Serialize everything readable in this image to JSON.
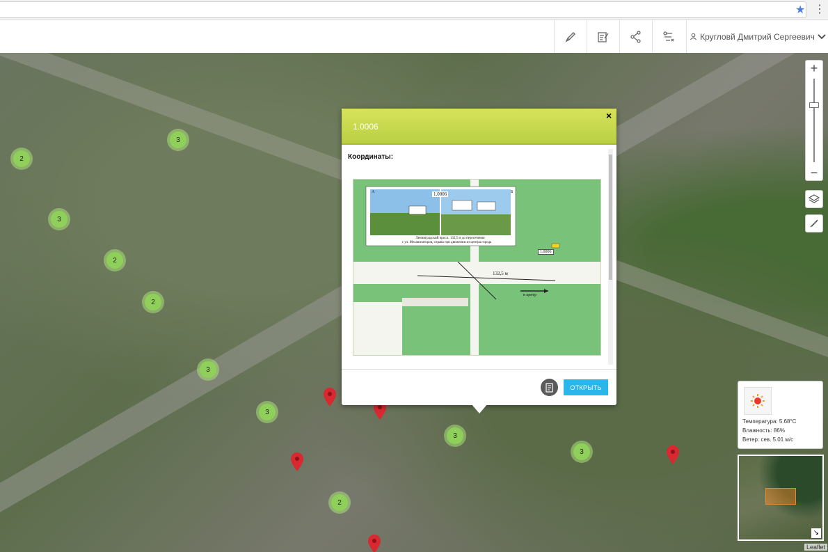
{
  "toolbar": {
    "buttons": [
      {
        "icon": "pencil-icon"
      },
      {
        "icon": "edit-note-icon"
      },
      {
        "icon": "share-icon"
      },
      {
        "icon": "route-icon"
      }
    ],
    "user_name": "Кругловй Дмитрий Сергеевич"
  },
  "map": {
    "clusters": [
      "2",
      "3",
      "3",
      "2",
      "2",
      "3",
      "3",
      "3",
      "3",
      "2"
    ],
    "attribution": "Leaflet"
  },
  "popup": {
    "title": "1.0006",
    "coords_label": "Координаты:",
    "image": {
      "sign_id": "1.0006",
      "caption_line1": "Ленинградский просп. 132,5 м до пересечения",
      "caption_line2": "с ул. Механизаторов, справа при движении из центра города",
      "distance": "132,5 м",
      "direction": "в центр",
      "marker_label": "1.0006",
      "panel_a": "А",
      "panel_b": "Б"
    },
    "open_label": "ОТКРЫТЬ"
  },
  "weather": {
    "temperature": "Температура: 5.68°С",
    "humidity": "Влажность: 86%",
    "wind": "Ветер: сев. 5.01 м/с"
  }
}
